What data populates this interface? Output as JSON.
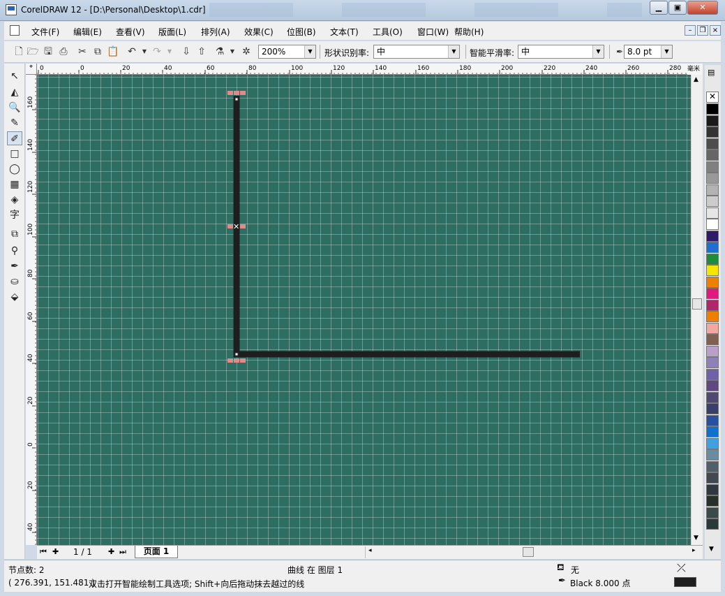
{
  "window": {
    "title": "CorelDRAW 12 - [D:\\Personal\\Desktop\\1.cdr]"
  },
  "menu": [
    "文件(F)",
    "编辑(E)",
    "查看(V)",
    "版面(L)",
    "排列(A)",
    "效果(C)",
    "位图(B)",
    "文本(T)",
    "工具(O)",
    "窗口(W)",
    "帮助(H)"
  ],
  "toolbar": {
    "zoom": "200%",
    "shape_recognition_label": "形状识别率:",
    "shape_recognition_value": "中",
    "smoothing_label": "智能平滑率:",
    "smoothing_value": "中",
    "outline_width": "8.0 pt"
  },
  "ruler": {
    "h_ticks": [
      "0",
      "0",
      "20",
      "40",
      "60",
      "80",
      "100",
      "120",
      "140",
      "160",
      "180",
      "200",
      "220",
      "240",
      "260",
      "280"
    ],
    "v_ticks": [
      "160",
      "140",
      "120",
      "100",
      "80",
      "60",
      "40",
      "20",
      "0",
      "20",
      "40"
    ],
    "unit": "毫米"
  },
  "page": {
    "indicator": "1 / 1",
    "tab": "页面 1"
  },
  "status": {
    "nodes": "节点数: 2",
    "object_info": "曲线 在 图层 1",
    "fill": "无",
    "coords": "( 276.391, 151.481 )",
    "hint": "双击打开智能绘制工具选项; Shift+向后拖动抹去越过的线",
    "outline": "Black  8.000 点"
  },
  "colors": {
    "canvas": "#2e6d62",
    "line": "#1e1e1e",
    "node": "#e08a8a",
    "palette": [
      "#000000",
      "#1a1a1a",
      "#333333",
      "#4d4d4d",
      "#666666",
      "#808080",
      "#999999",
      "#b3b3b3",
      "#cccccc",
      "#e6e6e6",
      "#ffffff",
      "#2d1b69",
      "#1f6fd1",
      "#1e8c3c",
      "#f5e600",
      "#f07f00",
      "#e0197d",
      "#b0266b",
      "#f07f00",
      "#f0a8a0",
      "#806050",
      "#b8a0c8",
      "#9080b8",
      "#7060a8",
      "#604880",
      "#504870",
      "#38406a",
      "#2850a0",
      "#1070d0",
      "#40a0e0",
      "#6a8ca0",
      "#50606a",
      "#404850",
      "#303840",
      "#28302a",
      "#3a4a48",
      "#2a3a38"
    ]
  }
}
